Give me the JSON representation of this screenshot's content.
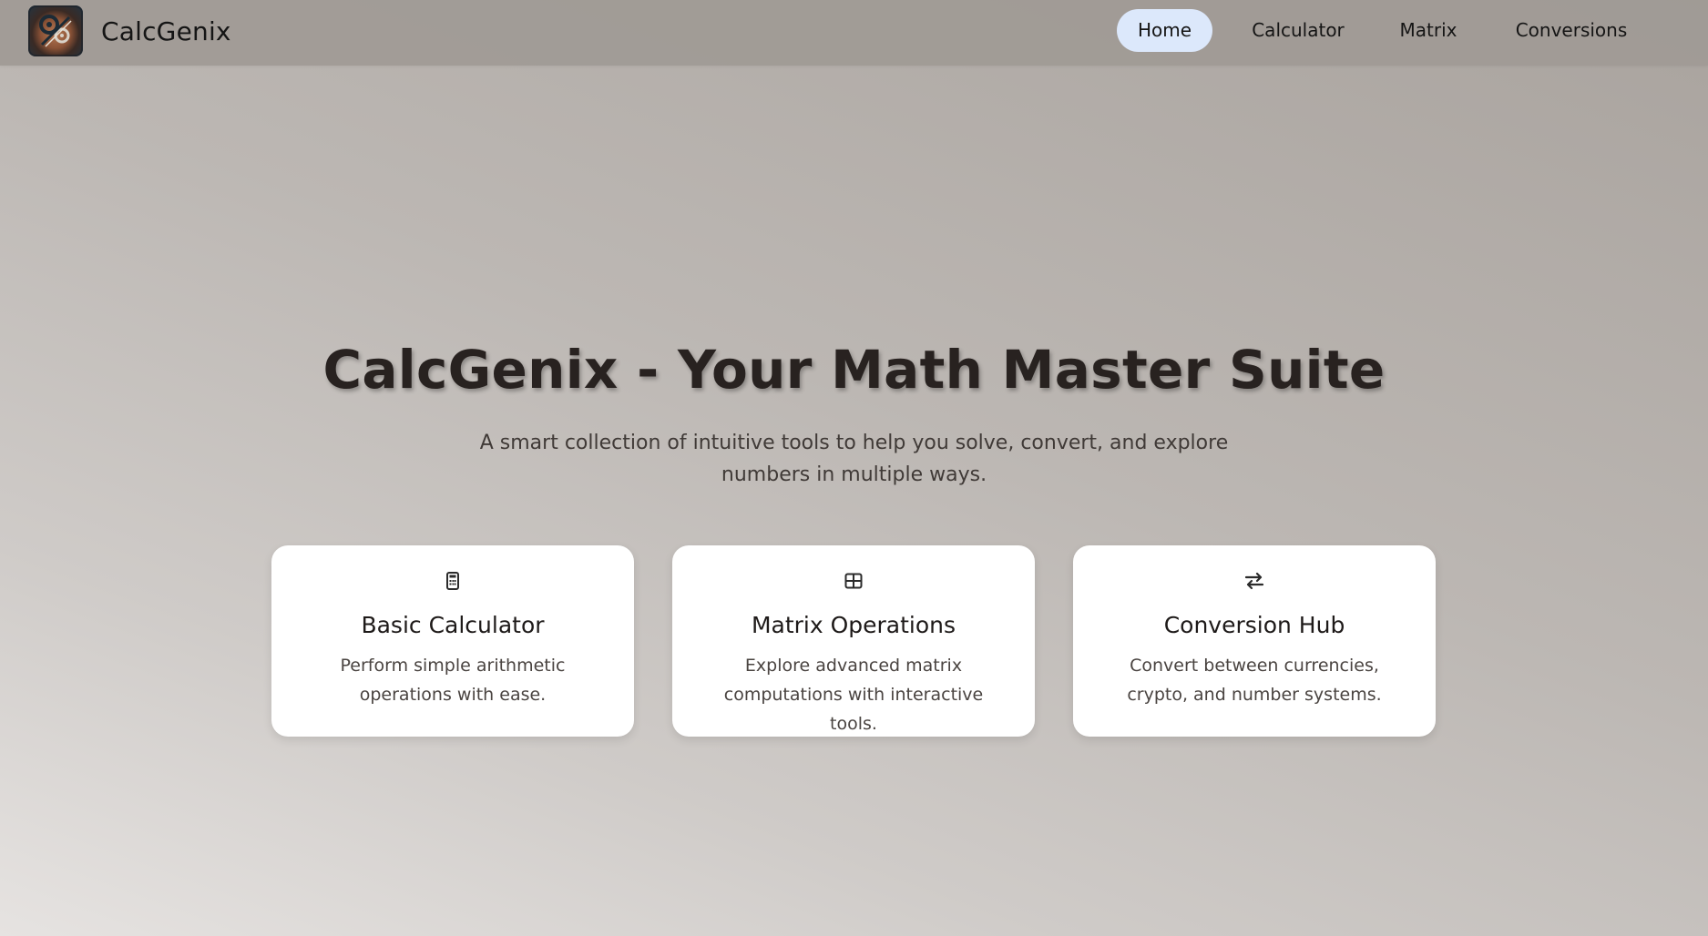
{
  "app": {
    "name": "CalcGenix",
    "logo_icon": "gears-logo-icon"
  },
  "nav": {
    "items": [
      {
        "label": "Home",
        "active": true
      },
      {
        "label": "Calculator",
        "active": false
      },
      {
        "label": "Matrix",
        "active": false
      },
      {
        "label": "Conversions",
        "active": false
      }
    ]
  },
  "hero": {
    "title": "CalcGenix - Your Math Master Suite",
    "subtitle": "A smart collection of intuitive tools to help you solve, convert, and explore numbers in multiple ways."
  },
  "cards": [
    {
      "icon": "calculator-icon",
      "title": "Basic Calculator",
      "description": "Perform simple arithmetic operations with ease."
    },
    {
      "icon": "table-grid-icon",
      "title": "Matrix Operations",
      "description": "Explore advanced matrix computations with interactive tools."
    },
    {
      "icon": "exchange-arrows-icon",
      "title": "Conversion Hub",
      "description": "Convert between currencies, crypto, and number systems."
    }
  ],
  "colors": {
    "nav_active_bg": "#dce8fb",
    "card_bg": "#ffffff",
    "title_text": "#282220"
  }
}
